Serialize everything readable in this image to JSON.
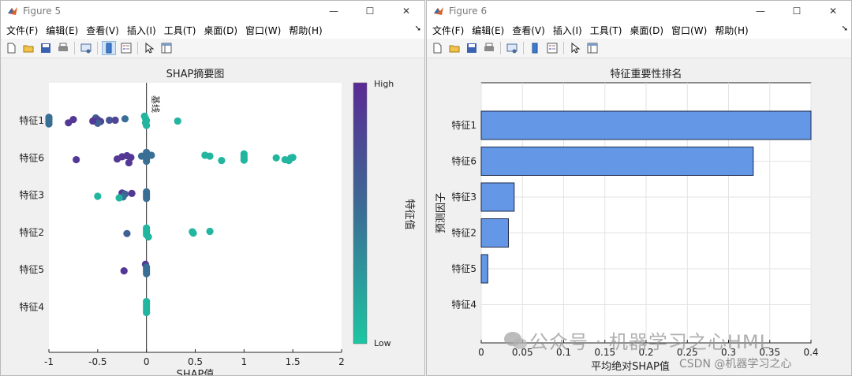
{
  "colors": {
    "low": "#1cc6a2",
    "mid": "#3a6f95",
    "high": "#5a2a95",
    "bar": "#6497e6",
    "bar_edge": "#1e2a4a",
    "axis": "#262626",
    "grid": "#e3e3e3"
  },
  "window_controls": {
    "minimize": "—",
    "maximize": "☐",
    "close": "✕"
  },
  "windows": [
    {
      "title": "Figure 5",
      "menus": [
        "文件(F)",
        "编辑(E)",
        "查看(V)",
        "插入(I)",
        "工具(T)",
        "桌面(D)",
        "窗口(W)",
        "帮助(H)"
      ],
      "toolbar_icons": [
        "new-file-icon",
        "open-folder-icon",
        "save-icon",
        "print-icon",
        "link-plot-icon",
        "colorbar-icon",
        "legend-icon",
        "pointer-icon",
        "property-editor-icon"
      ]
    },
    {
      "title": "Figure 6",
      "menus": [
        "文件(F)",
        "编辑(E)",
        "查看(V)",
        "插入(I)",
        "工具(T)",
        "桌面(D)",
        "窗口(W)",
        "帮助(H)"
      ],
      "toolbar_icons": [
        "new-file-icon",
        "open-folder-icon",
        "save-icon",
        "print-icon",
        "link-plot-icon",
        "colorbar-icon",
        "legend-icon",
        "pointer-icon",
        "property-editor-icon"
      ]
    }
  ],
  "chart_data": [
    {
      "type": "scatter",
      "title": "SHAP摘要图",
      "xlabel": "SHAP值",
      "ylabel": "",
      "xlim": [
        -1,
        2
      ],
      "xticks": [
        -1,
        -0.5,
        0,
        0.5,
        1,
        1.5,
        2
      ],
      "xtick_labels": [
        "-1",
        "-0.5",
        "0",
        "0.5",
        "1",
        "1.5",
        "2"
      ],
      "categories": [
        "特征1",
        "特征6",
        "特征3",
        "特征2",
        "特征5",
        "特征4"
      ],
      "baseline_label": "基线",
      "baseline_x": 0,
      "colorbar": {
        "label": "特征值",
        "high_label": "High",
        "low_label": "Low"
      },
      "points": [
        {
          "feature": "特征1",
          "x": -1.0,
          "dy": -0.15,
          "v": 0.5
        },
        {
          "feature": "特征1",
          "x": -1.0,
          "dy": -0.05,
          "v": 0.5
        },
        {
          "feature": "特征1",
          "x": -1.0,
          "dy": 0.05,
          "v": 0.5
        },
        {
          "feature": "特征1",
          "x": -1.0,
          "dy": 0.15,
          "v": 0.5
        },
        {
          "feature": "特征1",
          "x": -0.8,
          "dy": 0.1,
          "v": 0.9
        },
        {
          "feature": "特征1",
          "x": -0.75,
          "dy": -0.05,
          "v": 0.9
        },
        {
          "feature": "特征1",
          "x": -0.52,
          "dy": -0.12,
          "v": 0.6
        },
        {
          "feature": "特征1",
          "x": -0.5,
          "dy": -0.04,
          "v": 0.8
        },
        {
          "feature": "特征1",
          "x": -0.47,
          "dy": 0.04,
          "v": 0.8
        },
        {
          "feature": "特征1",
          "x": -0.5,
          "dy": 0.12,
          "v": 0.6
        },
        {
          "feature": "特征1",
          "x": -0.55,
          "dy": 0.02,
          "v": 0.9
        },
        {
          "feature": "特征1",
          "x": -0.38,
          "dy": -0.02,
          "v": 0.7
        },
        {
          "feature": "特征1",
          "x": -0.32,
          "dy": -0.02,
          "v": 0.8
        },
        {
          "feature": "特征1",
          "x": -0.22,
          "dy": -0.08,
          "v": 0.5
        },
        {
          "feature": "特征1",
          "x": -0.02,
          "dy": -0.2,
          "v": 0.1
        },
        {
          "feature": "特征1",
          "x": -0.01,
          "dy": -0.1,
          "v": 0.1
        },
        {
          "feature": "特征1",
          "x": 0.0,
          "dy": 0.0,
          "v": 0.1
        },
        {
          "feature": "特征1",
          "x": -0.01,
          "dy": 0.1,
          "v": 0.1
        },
        {
          "feature": "特征1",
          "x": 0.0,
          "dy": 0.22,
          "v": 0.1
        },
        {
          "feature": "特征1",
          "x": 0.32,
          "dy": 0.02,
          "v": 0.1
        },
        {
          "feature": "特征6",
          "x": -0.72,
          "dy": 0.08,
          "v": 0.9
        },
        {
          "feature": "特征6",
          "x": -0.3,
          "dy": 0.05,
          "v": 0.9
        },
        {
          "feature": "特征6",
          "x": -0.25,
          "dy": -0.05,
          "v": 0.9
        },
        {
          "feature": "特征6",
          "x": -0.2,
          "dy": -0.1,
          "v": 0.9
        },
        {
          "feature": "特征6",
          "x": -0.16,
          "dy": -0.02,
          "v": 0.9
        },
        {
          "feature": "特征6",
          "x": -0.18,
          "dy": 0.22,
          "v": 0.9
        },
        {
          "feature": "特征6",
          "x": -0.05,
          "dy": -0.08,
          "v": 0.5
        },
        {
          "feature": "特征6",
          "x": 0.0,
          "dy": -0.25,
          "v": 0.5
        },
        {
          "feature": "特征6",
          "x": 0.0,
          "dy": -0.15,
          "v": 0.5
        },
        {
          "feature": "特征6",
          "x": 0.0,
          "dy": -0.05,
          "v": 0.5
        },
        {
          "feature": "特征6",
          "x": 0.0,
          "dy": 0.05,
          "v": 0.5
        },
        {
          "feature": "特征6",
          "x": 0.0,
          "dy": 0.15,
          "v": 0.5
        },
        {
          "feature": "特征6",
          "x": 0.05,
          "dy": -0.12,
          "v": 0.5
        },
        {
          "feature": "特征6",
          "x": 0.6,
          "dy": -0.12,
          "v": 0.1
        },
        {
          "feature": "特征6",
          "x": 0.65,
          "dy": -0.08,
          "v": 0.1
        },
        {
          "feature": "特征6",
          "x": 0.77,
          "dy": 0.12,
          "v": 0.1
        },
        {
          "feature": "特征6",
          "x": 1.0,
          "dy": -0.18,
          "v": 0.1
        },
        {
          "feature": "特征6",
          "x": 1.0,
          "dy": -0.08,
          "v": 0.1
        },
        {
          "feature": "特征6",
          "x": 1.0,
          "dy": 0.02,
          "v": 0.1
        },
        {
          "feature": "特征6",
          "x": 1.0,
          "dy": 0.1,
          "v": 0.1
        },
        {
          "feature": "特征6",
          "x": 1.33,
          "dy": 0.0,
          "v": 0.1
        },
        {
          "feature": "特征6",
          "x": 1.42,
          "dy": 0.08,
          "v": 0.1
        },
        {
          "feature": "特征6",
          "x": 1.46,
          "dy": 0.12,
          "v": 0.1
        },
        {
          "feature": "特征6",
          "x": 1.48,
          "dy": 0.0,
          "v": 0.1
        },
        {
          "feature": "特征6",
          "x": 1.5,
          "dy": -0.02,
          "v": 0.1
        },
        {
          "feature": "特征3",
          "x": -0.5,
          "dy": 0.05,
          "v": 0.1
        },
        {
          "feature": "特征3",
          "x": -0.25,
          "dy": -0.1,
          "v": 0.9
        },
        {
          "feature": "特征3",
          "x": -0.22,
          "dy": -0.05,
          "v": 0.6
        },
        {
          "feature": "特征3",
          "x": -0.24,
          "dy": 0.08,
          "v": 0.5
        },
        {
          "feature": "特征3",
          "x": -0.28,
          "dy": 0.12,
          "v": 0.1
        },
        {
          "feature": "特征3",
          "x": -0.15,
          "dy": -0.08,
          "v": 0.9
        },
        {
          "feature": "特征3",
          "x": 0.0,
          "dy": -0.15,
          "v": 0.5
        },
        {
          "feature": "特征3",
          "x": 0.0,
          "dy": -0.05,
          "v": 0.5
        },
        {
          "feature": "特征3",
          "x": 0.0,
          "dy": 0.05,
          "v": 0.5
        },
        {
          "feature": "特征3",
          "x": 0.0,
          "dy": 0.15,
          "v": 0.5
        },
        {
          "feature": "特征2",
          "x": -0.2,
          "dy": 0.05,
          "v": 0.6
        },
        {
          "feature": "特征2",
          "x": 0.0,
          "dy": -0.2,
          "v": 0.1
        },
        {
          "feature": "特征2",
          "x": 0.0,
          "dy": -0.1,
          "v": 0.1
        },
        {
          "feature": "特征2",
          "x": 0.0,
          "dy": 0.0,
          "v": 0.1
        },
        {
          "feature": "特征2",
          "x": 0.0,
          "dy": 0.1,
          "v": 0.1
        },
        {
          "feature": "特征2",
          "x": 0.02,
          "dy": 0.2,
          "v": 0.1
        },
        {
          "feature": "特征2",
          "x": 0.47,
          "dy": -0.03,
          "v": 0.1
        },
        {
          "feature": "特征2",
          "x": 0.48,
          "dy": 0.03,
          "v": 0.1
        },
        {
          "feature": "特征2",
          "x": 0.65,
          "dy": -0.05,
          "v": 0.1
        },
        {
          "feature": "特征5",
          "x": -0.23,
          "dy": 0.05,
          "v": 0.9
        },
        {
          "feature": "特征5",
          "x": -0.01,
          "dy": -0.25,
          "v": 0.9
        },
        {
          "feature": "特征5",
          "x": 0.0,
          "dy": -0.12,
          "v": 0.5
        },
        {
          "feature": "特征5",
          "x": 0.0,
          "dy": -0.02,
          "v": 0.5
        },
        {
          "feature": "特征5",
          "x": 0.0,
          "dy": 0.08,
          "v": 0.5
        },
        {
          "feature": "特征5",
          "x": 0.0,
          "dy": 0.18,
          "v": 0.5
        },
        {
          "feature": "特征4",
          "x": 0.0,
          "dy": -0.25,
          "v": 0.1
        },
        {
          "feature": "特征4",
          "x": 0.0,
          "dy": -0.15,
          "v": 0.1
        },
        {
          "feature": "特征4",
          "x": 0.0,
          "dy": -0.05,
          "v": 0.1
        },
        {
          "feature": "特征4",
          "x": 0.0,
          "dy": 0.05,
          "v": 0.1
        },
        {
          "feature": "特征4",
          "x": 0.0,
          "dy": 0.15,
          "v": 0.1
        },
        {
          "feature": "特征4",
          "x": 0.0,
          "dy": 0.25,
          "v": 0.1
        }
      ]
    },
    {
      "type": "bar",
      "orientation": "horizontal",
      "title": "特征重要性排名",
      "xlabel": "平均绝对SHAP值",
      "ylabel": "预测因子",
      "xlim": [
        0,
        0.4
      ],
      "xticks": [
        0,
        0.05,
        0.1,
        0.15,
        0.2,
        0.25,
        0.3,
        0.35,
        0.4
      ],
      "xtick_labels": [
        "0",
        "0.05",
        "0.1",
        "0.15",
        "0.2",
        "0.25",
        "0.3",
        "0.35",
        "0.4"
      ],
      "grid": true,
      "categories": [
        "特征1",
        "特征6",
        "特征3",
        "特征2",
        "特征5",
        "特征4"
      ],
      "values": [
        0.4,
        0.33,
        0.04,
        0.033,
        0.008,
        0.0
      ]
    }
  ],
  "watermark": {
    "text": "公众号 · 机器学习之心HML",
    "sub": "CSDN @机器学习之心"
  }
}
